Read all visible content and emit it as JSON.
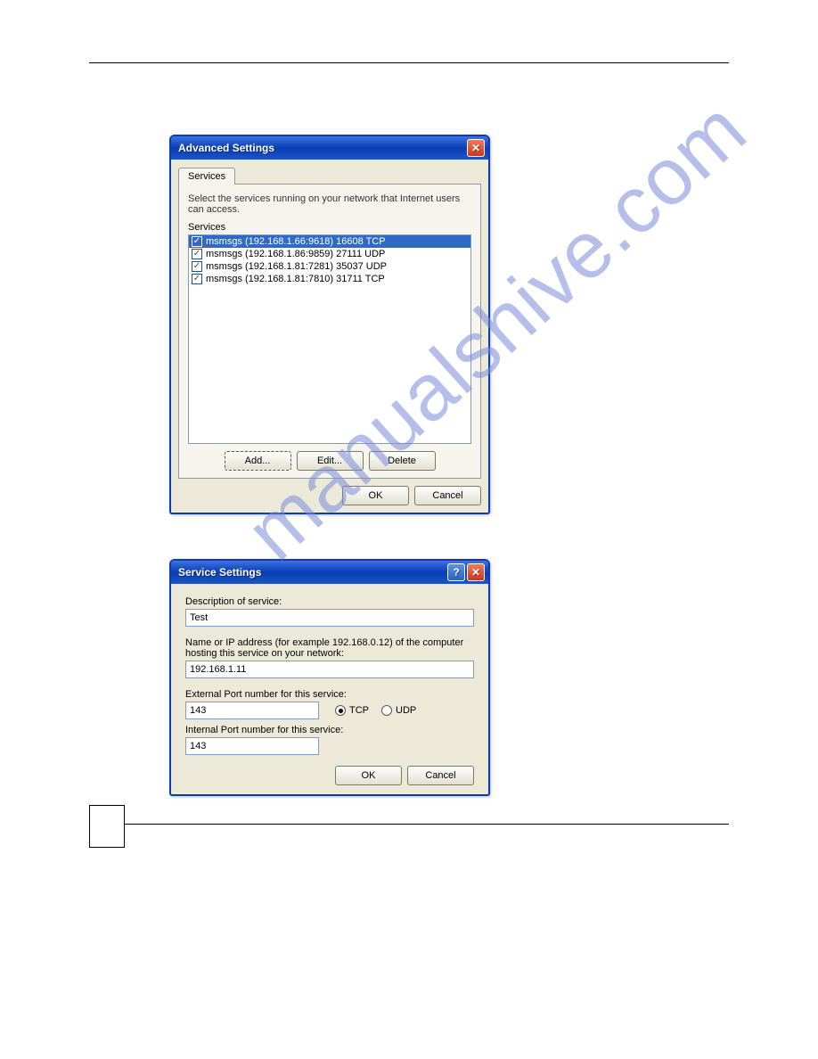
{
  "watermark": "manualshive.com",
  "advanced": {
    "title": "Advanced Settings",
    "tab": "Services",
    "note": "Select the services running on your network that Internet users can access.",
    "list_label": "Services",
    "items": [
      {
        "label": "msmsgs (192.168.1.66:9618) 16608 TCP"
      },
      {
        "label": "msmsgs (192.168.1.86:9859) 27111 UDP"
      },
      {
        "label": "msmsgs (192.168.1.81:7281) 35037 UDP"
      },
      {
        "label": "msmsgs (192.168.1.81:7810) 31711 TCP"
      }
    ],
    "buttons": {
      "add": "Add...",
      "edit": "Edit...",
      "delete": "Delete"
    },
    "ok": "OK",
    "cancel": "Cancel"
  },
  "service": {
    "title": "Service Settings",
    "desc_label": "Description of service:",
    "desc_value": "Test",
    "ip_label": "Name or IP address (for example 192.168.0.12) of the computer hosting this service on your network:",
    "ip_value": "192.168.1.11",
    "ext_label": "External Port number for this service:",
    "ext_value": "143",
    "int_label": "Internal Port number for this service:",
    "int_value": "143",
    "tcp": "TCP",
    "udp": "UDP",
    "ok": "OK",
    "cancel": "Cancel"
  }
}
